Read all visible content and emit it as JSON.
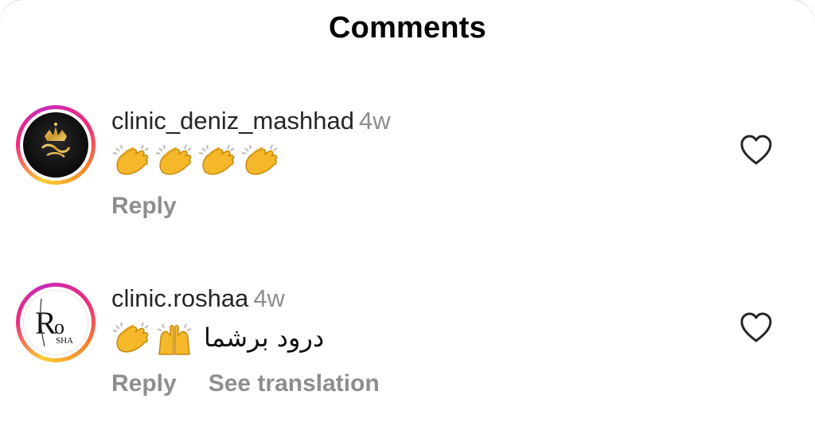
{
  "header": {
    "title": "Comments"
  },
  "comments": [
    {
      "username": "clinic_deniz_mashhad",
      "time": "4w",
      "emoji": [
        "clapping-hands",
        "clapping-hands",
        "clapping-hands",
        "clapping-hands"
      ],
      "text": "",
      "actions": {
        "reply": "Reply",
        "translate": ""
      }
    },
    {
      "username": "clinic.roshaa",
      "time": "4w",
      "emoji": [
        "clapping-hands",
        "raising-hands"
      ],
      "text": "درود برشما",
      "actions": {
        "reply": "Reply",
        "translate": "See translation"
      }
    }
  ],
  "avatars": {
    "first": {
      "logo_text": ""
    },
    "second": {
      "logo_text": "RoSHA"
    }
  },
  "colors": {
    "text": "#262626",
    "secondary": "#8e8e8e",
    "ring": [
      "#f9ce34",
      "#ee2a7b",
      "#c72cb9"
    ]
  }
}
